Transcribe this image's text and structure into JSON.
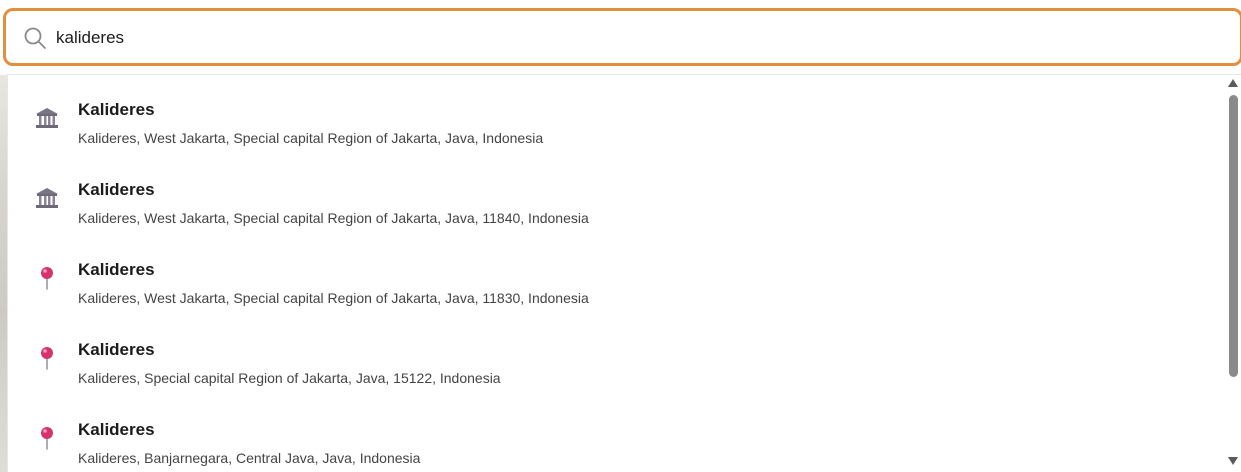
{
  "search": {
    "value": "kalideres",
    "icon": "search-icon"
  },
  "results": [
    {
      "name": "Kalideres",
      "address": "Kalideres, West Jakarta, Special capital Region of Jakarta, Java, Indonesia",
      "icon": "government-building-icon"
    },
    {
      "name": "Kalideres",
      "address": "Kalideres, West Jakarta, Special capital Region of Jakarta, Java, 11840, Indonesia",
      "icon": "government-building-icon"
    },
    {
      "name": "Kalideres",
      "address": "Kalideres, West Jakarta, Special capital Region of Jakarta, Java, 11830, Indonesia",
      "icon": "map-pin-icon"
    },
    {
      "name": "Kalideres",
      "address": "Kalideres, Special capital Region of Jakarta, Java, 15122, Indonesia",
      "icon": "map-pin-icon"
    },
    {
      "name": "Kalideres",
      "address": "Kalideres, Banjarnegara, Central Java, Java, Indonesia",
      "icon": "map-pin-icon"
    }
  ],
  "colors": {
    "focus_border": "#e18f3c",
    "pin": "#d6336c",
    "building": "#8a8494"
  }
}
